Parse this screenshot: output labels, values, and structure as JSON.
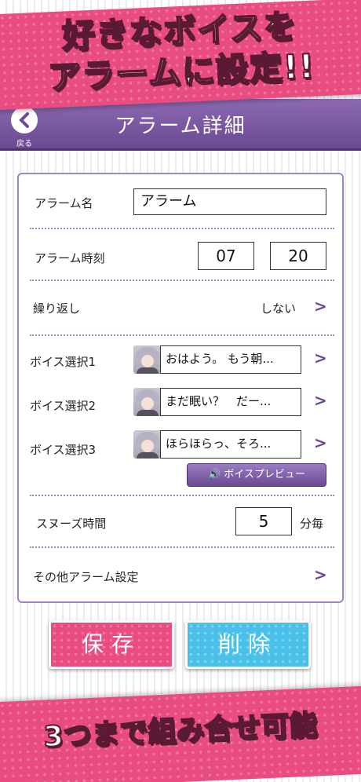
{
  "promo_top": {
    "line1_highlight": "好きなボイス",
    "line1_rest": "を",
    "line2": "アラームに設定!!"
  },
  "header": {
    "back_label": "戻る",
    "title": "アラーム詳細"
  },
  "form": {
    "alarm_name_label": "アラーム名",
    "alarm_name_value": "アラーム",
    "alarm_time_label": "アラーム時刻",
    "hour": "07",
    "minute": "20",
    "repeat_label": "繰り返し",
    "repeat_value": "しない",
    "voices": [
      {
        "label": "ボイス選択1",
        "text": "おはよう。 もう朝..."
      },
      {
        "label": "ボイス選択2",
        "text": "まだ眠い？　だー..."
      },
      {
        "label": "ボイス選択3",
        "text": "ほらほらっ、そろ..."
      }
    ],
    "voice_preview_label": "ボイスプレビュー",
    "snooze_label": "スヌーズ時間",
    "snooze_value": "5",
    "snooze_unit": "分毎",
    "other_settings_label": "その他アラーム設定"
  },
  "buttons": {
    "save": "保存",
    "delete": "削除"
  },
  "promo_bottom": {
    "text": "3つまで組み合せ可能"
  },
  "colors": {
    "accent_purple": "#6a4a92",
    "pink": "#e94c80",
    "blue": "#49c0e8"
  }
}
